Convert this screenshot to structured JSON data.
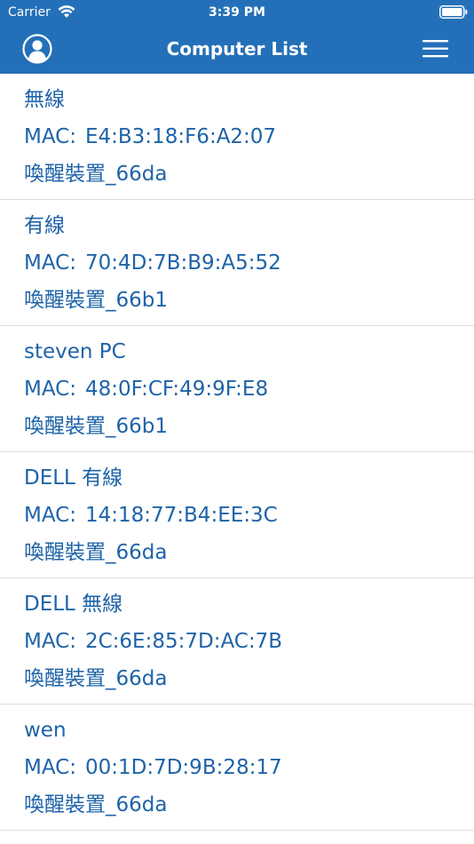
{
  "status_bar": {
    "carrier": "Carrier",
    "time": "3:39 PM"
  },
  "nav": {
    "title": "Computer List",
    "left_icon": "user-circle-icon",
    "right_icon": "hamburger-menu-icon"
  },
  "mac_label": "MAC:",
  "computers": [
    {
      "name": "無線",
      "mac": "E4:B3:18:F6:A2:07",
      "device": "喚醒裝置_66da"
    },
    {
      "name": "有線",
      "mac": "70:4D:7B:B9:A5:52",
      "device": "喚醒裝置_66b1"
    },
    {
      "name": "steven PC",
      "mac": "48:0F:CF:49:9F:E8",
      "device": "喚醒裝置_66b1"
    },
    {
      "name": "DELL 有線",
      "mac": "14:18:77:B4:EE:3C",
      "device": "喚醒裝置_66da"
    },
    {
      "name": "DELL 無線",
      "mac": "2C:6E:85:7D:AC:7B",
      "device": "喚醒裝置_66da"
    },
    {
      "name": "wen",
      "mac": "00:1D:7D:9B:28:17",
      "device": "喚醒裝置_66da"
    }
  ],
  "colors": {
    "header": "#2470b8",
    "text": "#1e63a8",
    "separator": "#dddddd"
  }
}
